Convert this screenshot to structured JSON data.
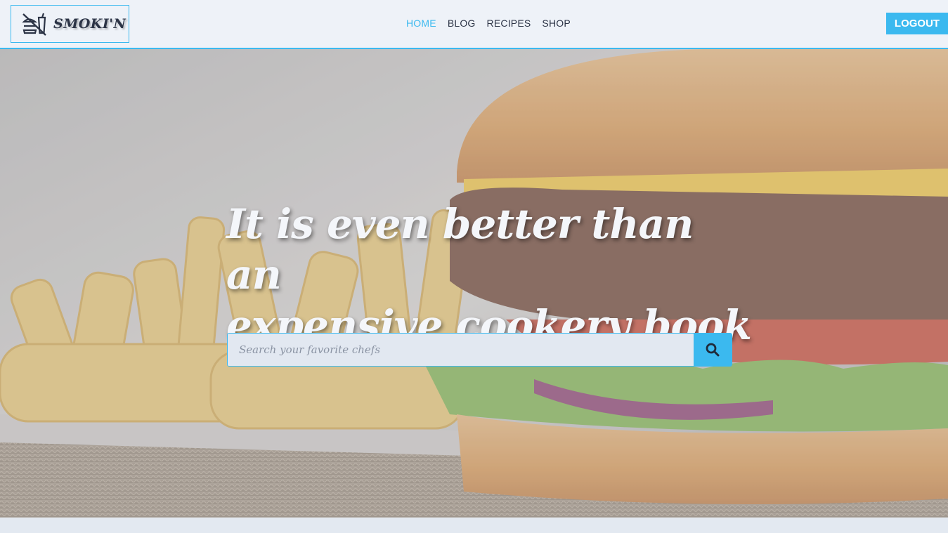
{
  "brand": {
    "name": "SMOKI'N",
    "logo_icon": "no-food-icon"
  },
  "nav": {
    "items": [
      {
        "label": "HOME",
        "active": true
      },
      {
        "label": "BLOG",
        "active": false
      },
      {
        "label": "RECIPES",
        "active": false
      },
      {
        "label": "SHOP",
        "active": false
      }
    ],
    "logout_label": "LOGOUT"
  },
  "hero": {
    "title_line1": "It is even better than an",
    "title_line2": "expensive cookery book",
    "background": "burger-and-fries-photo"
  },
  "search": {
    "placeholder": "Search your favorite chefs",
    "value": "",
    "icon": "search-icon"
  },
  "colors": {
    "accent": "#3bb9ef",
    "header_bg": "#eef2f8",
    "text_dark": "#2c3446",
    "page_bg": "#e3e9f1"
  }
}
